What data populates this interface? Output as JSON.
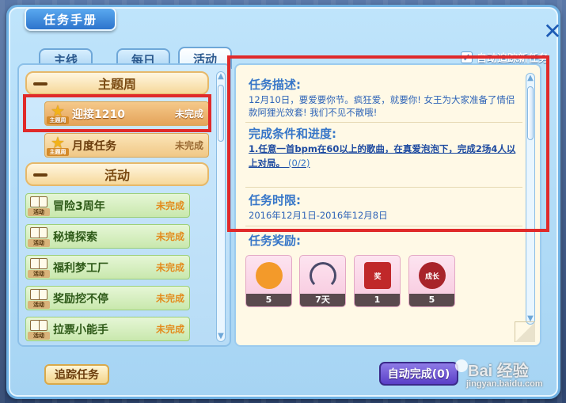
{
  "window": {
    "title": "任务手册",
    "close_glyph": "✕"
  },
  "tabs": [
    {
      "label": "主线",
      "active": false
    },
    {
      "label": "每日",
      "active": false
    },
    {
      "label": "活动",
      "active": true
    }
  ],
  "auto_track": {
    "label": "自动追踪新任务",
    "checked": true,
    "check_glyph": "✓"
  },
  "quest_list": {
    "categories": [
      {
        "label": "主题周",
        "items": [
          {
            "name": "迎接1210",
            "status": "未完成",
            "icon": "star-icon",
            "icon_tag": "主题周",
            "selected": true
          },
          {
            "name": "月度任务",
            "status": "未完成",
            "icon": "star-icon",
            "icon_tag": "主题周",
            "selected": false
          }
        ]
      },
      {
        "label": "活动",
        "items": [
          {
            "name": "冒险3周年",
            "status": "未完成",
            "icon": "book-icon",
            "icon_tag": "活动"
          },
          {
            "name": "秘境探索",
            "status": "未完成",
            "icon": "book-icon",
            "icon_tag": "活动"
          },
          {
            "name": "福利梦工厂",
            "status": "未完成",
            "icon": "book-icon",
            "icon_tag": "活动"
          },
          {
            "name": "奖励挖不停",
            "status": "未完成",
            "icon": "book-icon",
            "icon_tag": "活动"
          },
          {
            "name": "拉票小能手",
            "status": "未完成",
            "icon": "book-icon",
            "icon_tag": "活动"
          }
        ]
      }
    ]
  },
  "detail": {
    "description_title": "任务描述:",
    "description_text": "12月10日，要爱要你节。疯狂爱，就要你! 女王为大家准备了情侣款阿狸光效套! 我们不见不散哦!",
    "condition_title": "完成条件和进度:",
    "condition_text": "1.任意一首bpm在60以上的歌曲，在真爱泡泡下，完成2场4人以上对局。",
    "condition_progress": "(0/2)",
    "time_limit_title": "任务时限:",
    "time_limit_text": "2016年12月1日-2016年12月8日",
    "reward_title": "任务奖励:",
    "rewards": [
      {
        "icon": "orange-fruit-icon",
        "count": "5",
        "color": "#f39a2a"
      },
      {
        "icon": "headphones-icon",
        "count": "7天",
        "color": "#e6e6f2"
      },
      {
        "icon": "red-envelope-icon",
        "count": "1",
        "color": "#c0282a",
        "art_text": "奖"
      },
      {
        "icon": "growth-apple-icon",
        "count": "5",
        "color": "#a8232a",
        "art_text": "成长"
      }
    ]
  },
  "buttons": {
    "track": "追踪任务",
    "auto_complete": "自动完成(0)"
  },
  "watermark": {
    "main": "Bai 经验",
    "sub": "jingyan.baidu.com"
  },
  "colors": {
    "highlight_box": "#e02a2a",
    "accent": "#3676c8"
  }
}
